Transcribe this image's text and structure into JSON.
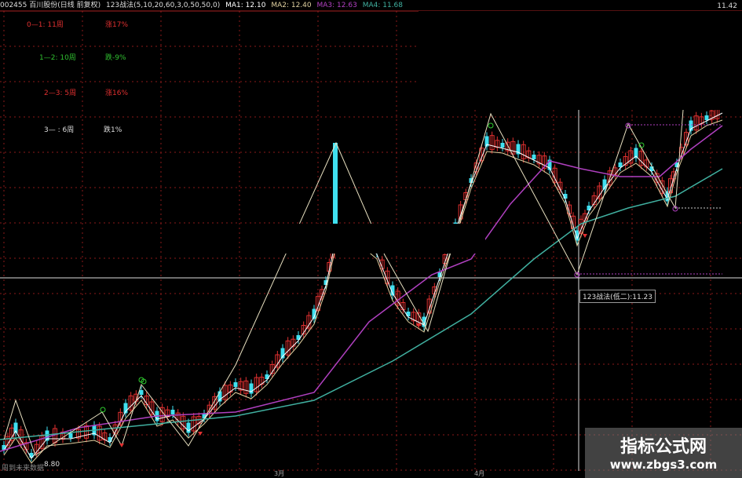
{
  "header": {
    "stock": "002455 百川股份(日线 前复权)",
    "indicator": "123战法(5,10,20,60,3,0,50,50,0)",
    "ma1": "MA1: 12.10",
    "ma2": "MA2: 12.40",
    "ma3": "MA3: 12.63",
    "ma4": "MA4: 11.68",
    "price_right": "11.42"
  },
  "legend": [
    {
      "a": "0—1: 11周",
      "b": "涨17%",
      "color": "#e03030"
    },
    {
      "a": "1—2: 10周",
      "b": "跌-9%",
      "color": "#30c030"
    },
    {
      "a": "2—3: 5周",
      "b": "涨16%",
      "color": "#e03030"
    },
    {
      "a": "3— : 6周",
      "b": "跌1%",
      "color": "#dddddd"
    }
  ],
  "tooltip": "123战法(低二):11.23",
  "bottom_left": "周到未来数据",
  "low_value": "8.80",
  "x_labels": [
    "3月",
    "4月"
  ],
  "watermark": {
    "line1": "指标公式网",
    "line2": "www.zbgs3.com"
  },
  "colors": {
    "up": "#e03030",
    "down": "#40e0f0",
    "ma_short": "#ffffff",
    "ma_mid": "#e0d0a0",
    "ma_purple": "#b040c0",
    "ma_green": "#40b0a0",
    "zigzag": "#e8e0c0",
    "grid": "#8b1a1a"
  },
  "chart_data": {
    "type": "candlestick",
    "series": [
      {
        "name": "MA1"
      },
      {
        "name": "MA2"
      },
      {
        "name": "MA3"
      },
      {
        "name": "MA4"
      }
    ]
  }
}
